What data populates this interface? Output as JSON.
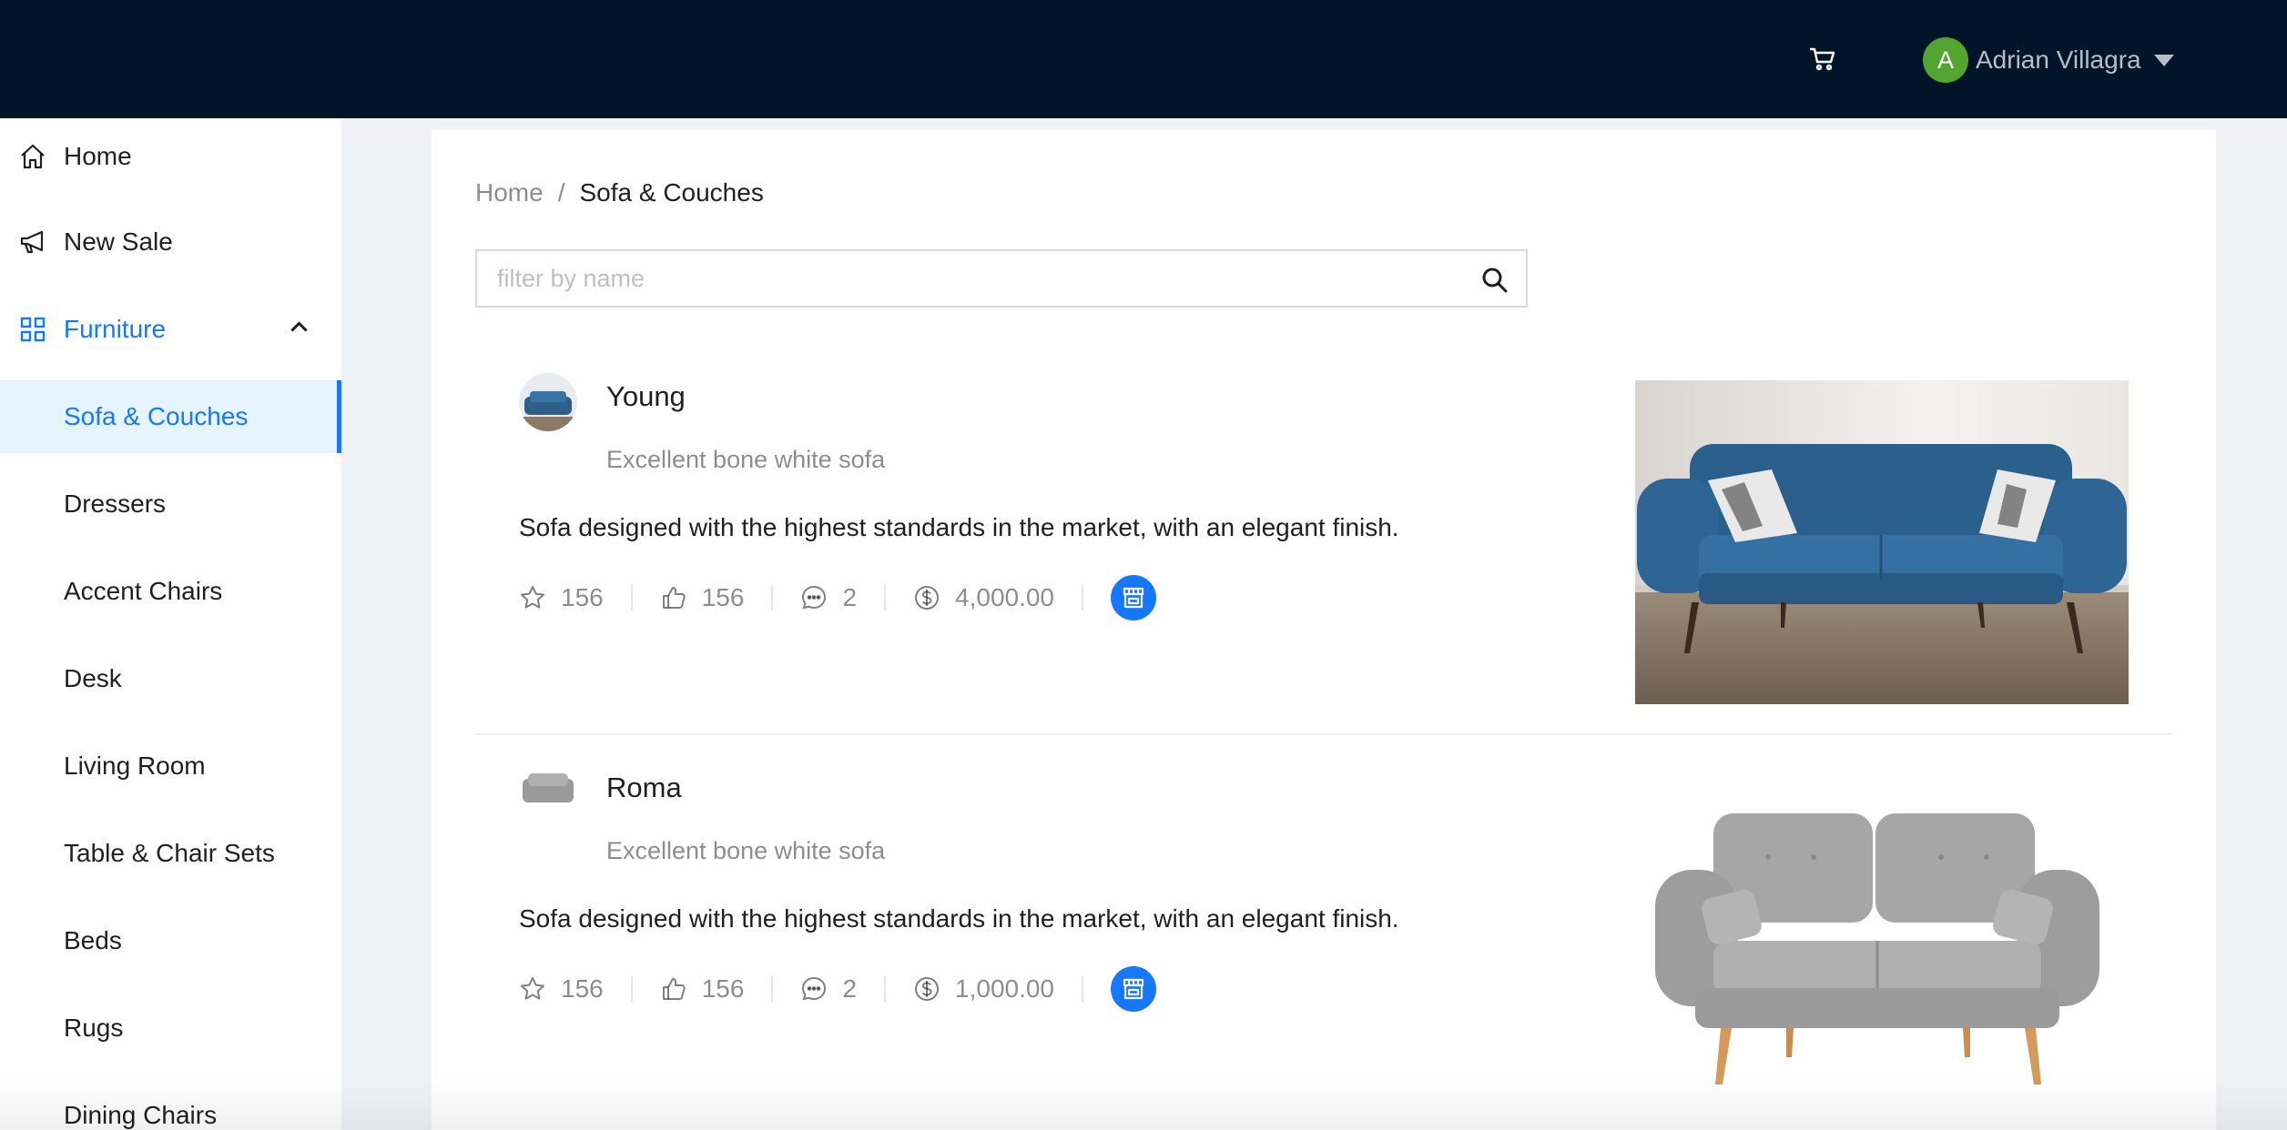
{
  "header": {
    "cart_icon": "shopping-cart-icon",
    "user": {
      "initial": "A",
      "name": "Adrian Villagra",
      "avatar_color": "#52a630"
    },
    "background": "#001529"
  },
  "sidebar": {
    "items": [
      {
        "label": "Home",
        "icon": "home-icon"
      },
      {
        "label": "New Sale",
        "icon": "megaphone-icon"
      },
      {
        "label": "Furniture",
        "icon": "appstore-icon",
        "expanded": true
      }
    ],
    "subitems": [
      {
        "label": "Sofa & Couches",
        "selected": true
      },
      {
        "label": "Dressers"
      },
      {
        "label": "Accent Chairs"
      },
      {
        "label": "Desk"
      },
      {
        "label": "Living Room"
      },
      {
        "label": "Table & Chair Sets"
      },
      {
        "label": "Beds"
      },
      {
        "label": "Rugs"
      },
      {
        "label": "Dining Chairs"
      }
    ],
    "accent_color": "#1677ff"
  },
  "breadcrumb": {
    "home": "Home",
    "separator": "/",
    "current": "Sofa & Couches"
  },
  "search": {
    "placeholder": "filter by name",
    "value": ""
  },
  "products": [
    {
      "title": "Young",
      "description": "Excellent bone white sofa",
      "content": "Sofa designed with the highest standards in the market, with an elegant finish.",
      "stars": "156",
      "likes": "156",
      "comments": "2",
      "price": "4,000.00",
      "image": "blue-sofa-image"
    },
    {
      "title": "Roma",
      "description": "Excellent bone white sofa",
      "content": "Sofa designed with the highest standards in the market, with an elegant finish.",
      "stars": "156",
      "likes": "156",
      "comments": "2",
      "price": "1,000.00",
      "image": "gray-sofa-image"
    }
  ]
}
